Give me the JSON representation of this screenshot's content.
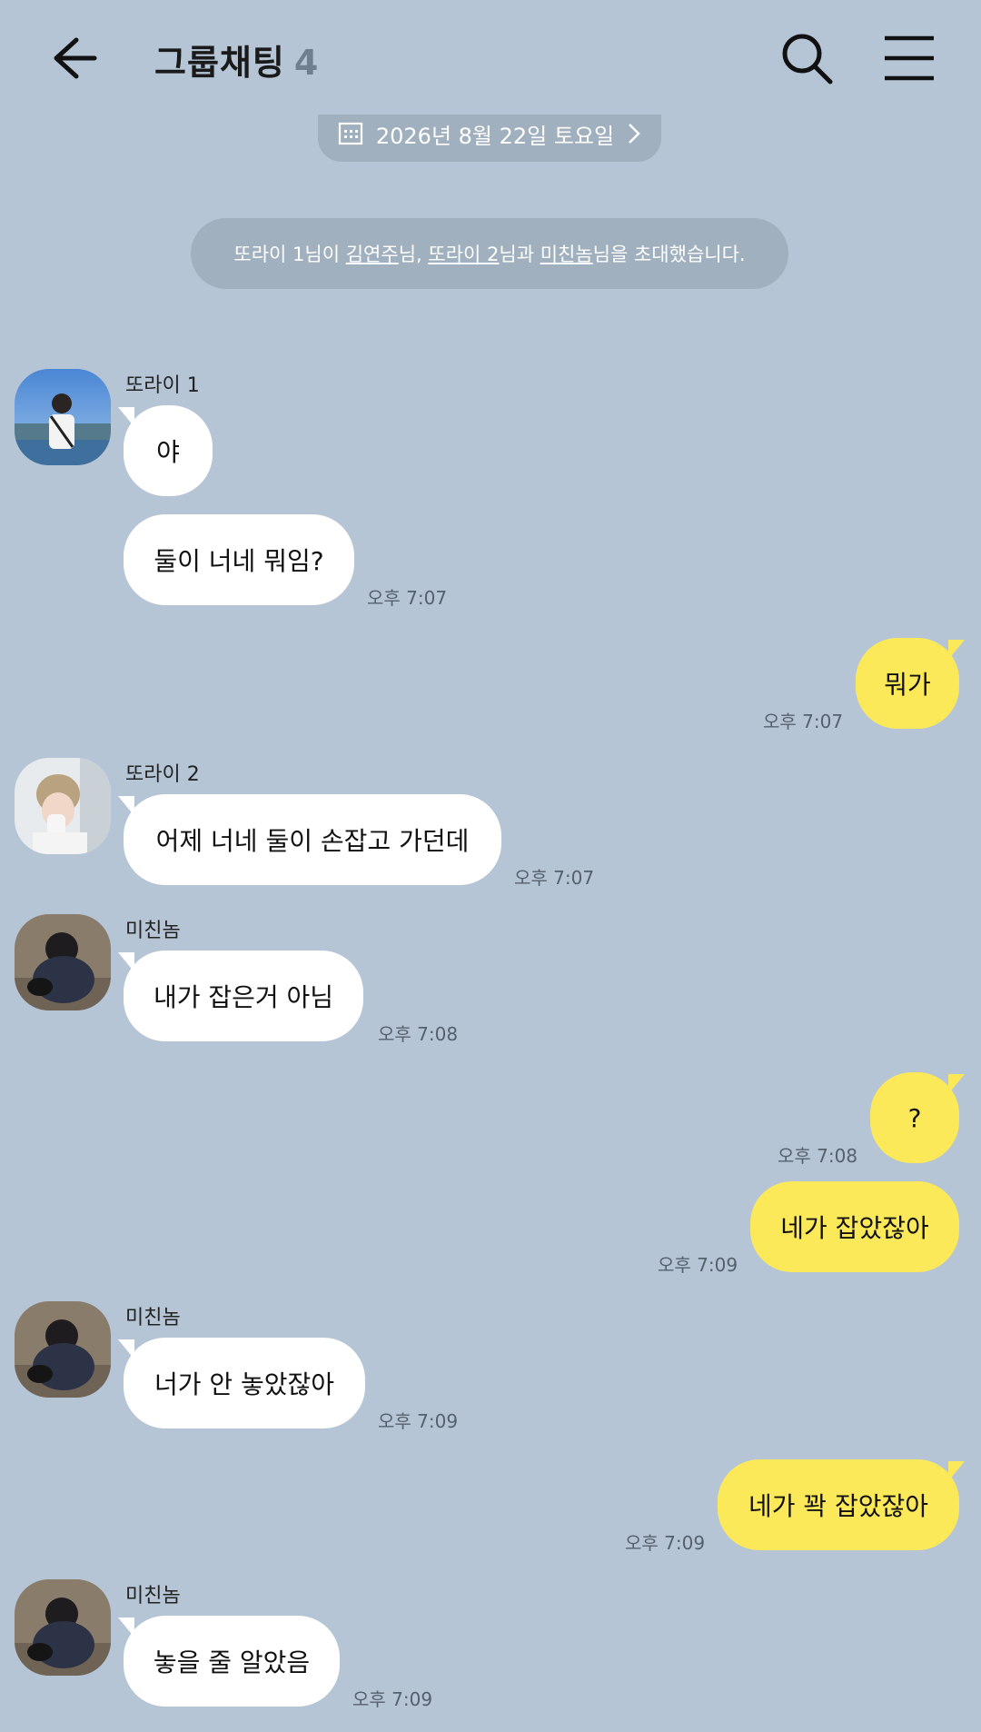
{
  "header": {
    "title": "그룹채팅",
    "member_count": "4"
  },
  "date_divider": "2026년 8월 22일 토요일",
  "system_message": {
    "inviter": "또라이 1",
    "p1": "님이 ",
    "invitee1": "김연주",
    "p2": "님, ",
    "invitee2": "또라이 2",
    "p3": "님과 ",
    "invitee3": "미친놈",
    "p4": "님을 초대했습니다."
  },
  "messages": [
    {
      "sender": "또라이 1",
      "text": "야",
      "time": ""
    },
    {
      "sender": "",
      "text": "둘이 너네 뭐임?",
      "time": "오후 7:07"
    },
    {
      "sender": "",
      "text": "뭐가",
      "time": "오후 7:07"
    },
    {
      "sender": "또라이 2",
      "text": "어제 너네 둘이 손잡고 가던데",
      "time": "오후 7:07"
    },
    {
      "sender": "미친놈",
      "text": "내가 잡은거 아님",
      "time": "오후 7:08"
    },
    {
      "sender": "",
      "text": "?",
      "time": "오후 7:08"
    },
    {
      "sender": "",
      "text": "네가 잡았잖아",
      "time": "오후 7:09"
    },
    {
      "sender": "미친놈",
      "text": "너가 안 놓았잖아",
      "time": "오후 7:09"
    },
    {
      "sender": "",
      "text": "네가 꽉 잡았잖아",
      "time": "오후 7:09"
    },
    {
      "sender": "미친놈",
      "text": "놓을 줄 알았음",
      "time": "오후 7:09"
    }
  ],
  "colors": {
    "background": "#b5c5d6",
    "my_bubble": "#fce95a",
    "their_bubble": "#ffffff",
    "pill": "#a1b0be"
  },
  "icons": [
    "back-arrow-icon",
    "search-icon",
    "menu-icon",
    "calendar-icon",
    "chevron-right-icon"
  ]
}
